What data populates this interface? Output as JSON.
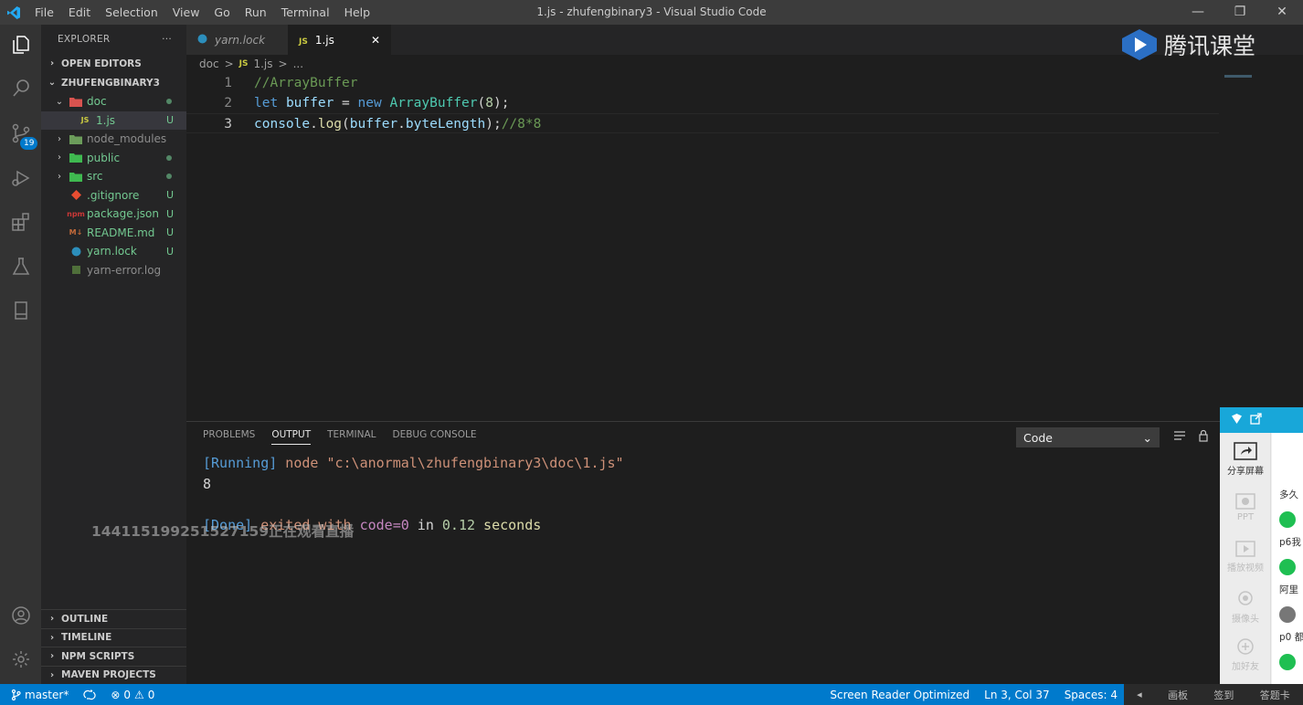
{
  "window": {
    "title": "1.js - zhufengbinary3 - Visual Studio Code",
    "menu": [
      "File",
      "Edit",
      "Selection",
      "View",
      "Go",
      "Run",
      "Terminal",
      "Help"
    ],
    "controls": [
      "—",
      "❐",
      "✕"
    ]
  },
  "activity": {
    "source_control_badge": "19"
  },
  "explorer": {
    "header": "EXPLORER",
    "more": "···",
    "open_editors": "OPEN EDITORS",
    "project": "ZHUFENGBINARY3",
    "items": [
      {
        "label": "doc",
        "status": "",
        "color": "#73c991"
      },
      {
        "label": "1.js",
        "status": "U",
        "color": "#73c991"
      },
      {
        "label": "node_modules",
        "status": "",
        "color": "#8c8c8c"
      },
      {
        "label": "public",
        "status": "",
        "color": "#73c991"
      },
      {
        "label": "src",
        "status": "",
        "color": "#73c991"
      },
      {
        "label": ".gitignore",
        "status": "U",
        "color": "#73c991"
      },
      {
        "label": "package.json",
        "status": "U",
        "color": "#73c991"
      },
      {
        "label": "README.md",
        "status": "U",
        "color": "#73c991"
      },
      {
        "label": "yarn.lock",
        "status": "U",
        "color": "#73c991"
      },
      {
        "label": "yarn-error.log",
        "status": "",
        "color": "#8c8c8c"
      }
    ],
    "bottom_sections": [
      "OUTLINE",
      "TIMELINE",
      "NPM SCRIPTS",
      "MAVEN PROJECTS"
    ]
  },
  "tabs": [
    {
      "label": "yarn.lock"
    },
    {
      "label": "1.js",
      "icon": "JS",
      "close": "✕"
    }
  ],
  "breadcrumb": [
    "doc",
    ">",
    "JS",
    "1.js",
    ">",
    "..."
  ],
  "editor": {
    "line_numbers": [
      "1",
      "2",
      "3"
    ],
    "lines": [
      [
        {
          "t": "//ArrayBuffer",
          "c": "c-com"
        }
      ],
      [
        {
          "t": "let",
          "c": "c-kw"
        },
        {
          "t": " ",
          "c": "c-plain"
        },
        {
          "t": "buffer",
          "c": "c-var"
        },
        {
          "t": " = ",
          "c": "c-plain"
        },
        {
          "t": "new",
          "c": "c-kw"
        },
        {
          "t": " ",
          "c": "c-plain"
        },
        {
          "t": "ArrayBuffer",
          "c": "c-cls"
        },
        {
          "t": "(",
          "c": "c-plain"
        },
        {
          "t": "8",
          "c": "c-num"
        },
        {
          "t": ");",
          "c": "c-plain"
        }
      ],
      [
        {
          "t": "console",
          "c": "c-var"
        },
        {
          "t": ".",
          "c": "c-plain"
        },
        {
          "t": "log",
          "c": "c-fn"
        },
        {
          "t": "(",
          "c": "c-plain"
        },
        {
          "t": "buffer",
          "c": "c-var"
        },
        {
          "t": ".",
          "c": "c-plain"
        },
        {
          "t": "byteLength",
          "c": "c-var"
        },
        {
          "t": ");",
          "c": "c-plain"
        },
        {
          "t": "//8*8",
          "c": "c-com"
        }
      ]
    ]
  },
  "panel": {
    "tabs": [
      "PROBLEMS",
      "OUTPUT",
      "TERMINAL",
      "DEBUG CONSOLE"
    ],
    "active_tab": "OUTPUT",
    "channel": "Code",
    "output": {
      "running_tag": "[Running]",
      "running_cmd": " node \"c:\\anormal\\zhufengbinary3\\doc\\1.js\"",
      "result": "8",
      "done_tag": "[Done]",
      "done_exited": " exited with ",
      "done_code": "code=0",
      "done_in": " in ",
      "done_time": "0.12",
      "done_seconds": " seconds"
    },
    "viewer_notice": "144115199251527159正在观看直播"
  },
  "status": {
    "branch": "master*",
    "errors": "0",
    "warnings": "0",
    "screen_reader": "Screen Reader Optimized",
    "position": "Ln 3, Col 37",
    "spaces": "Spaces: 4"
  },
  "tencent": {
    "brand": "腾讯课堂",
    "tools": [
      {
        "label": "分享屏幕",
        "enabled": true
      },
      {
        "label": "PPT",
        "enabled": false
      },
      {
        "label": "播放视频",
        "enabled": false
      },
      {
        "label": "摄像头",
        "enabled": false
      },
      {
        "label": "加好友",
        "enabled": false
      }
    ],
    "messages": [
      "多久",
      "p6我",
      "阿里",
      "p0 都"
    ],
    "bottom_bar": [
      "画板",
      "签到",
      "答题卡"
    ]
  },
  "colors": {
    "accent": "#007acc",
    "tencent_blue": "#18a7d9",
    "untracked": "#73c991"
  }
}
